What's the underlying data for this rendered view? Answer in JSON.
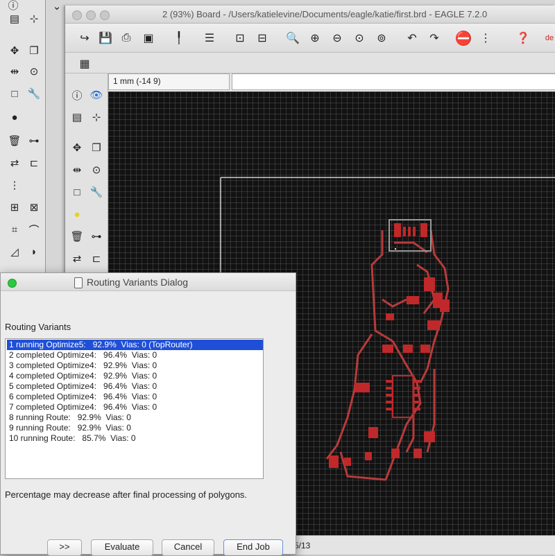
{
  "main_window": {
    "title": "2 (93%) Board - /Users/katielevine/Documents/eagle/katie/first.brd - EAGLE 7.2.0",
    "toolbar_icons": [
      "open-icon",
      "save-icon",
      "print-icon",
      "cam-icon",
      "script-icon",
      "run-icon",
      "board-icon",
      "schematic-icon",
      "zoom-fit-icon",
      "zoom-in-icon",
      "zoom-out-icon",
      "zoom-redraw-icon",
      "zoom-select-icon",
      "undo-icon",
      "redo-icon",
      "stop-icon",
      "go-icon",
      "help-icon"
    ],
    "coord_readout": "1 mm (-14 9)",
    "status_text": "5/13",
    "edge_label": "de"
  },
  "dialog": {
    "title": "Routing Variants Dialog",
    "section_label": "Routing Variants",
    "variants": [
      "1 running Optimize5:   92.9%  Vias: 0 (TopRouter)",
      "2 completed Optimize4:   96.4%  Vias: 0",
      "3 completed Optimize4:   92.9%  Vias: 0",
      "4 completed Optimize4:   92.9%  Vias: 0",
      "5 completed Optimize4:   96.4%  Vias: 0",
      "6 completed Optimize4:   96.4%  Vias: 0",
      "7 completed Optimize4:   96.4%  Vias: 0",
      "8 running Route:   92.9%  Vias: 0",
      "9 running Route:   92.9%  Vias: 0",
      "10 running Route:   85.7%  Vias: 0"
    ],
    "selected_index": 0,
    "note": "Percentage may decrease after final processing of polygons.",
    "buttons": {
      "more": ">>",
      "evaluate": "Evaluate",
      "cancel": "Cancel",
      "end_job": "End Job"
    }
  },
  "colors": {
    "selection": "#1f4fd8",
    "canvas_bg": "#121212",
    "board_outline": "#cfcfcf",
    "copper_pad": "#c0282a",
    "trace": "#b83a3a"
  }
}
